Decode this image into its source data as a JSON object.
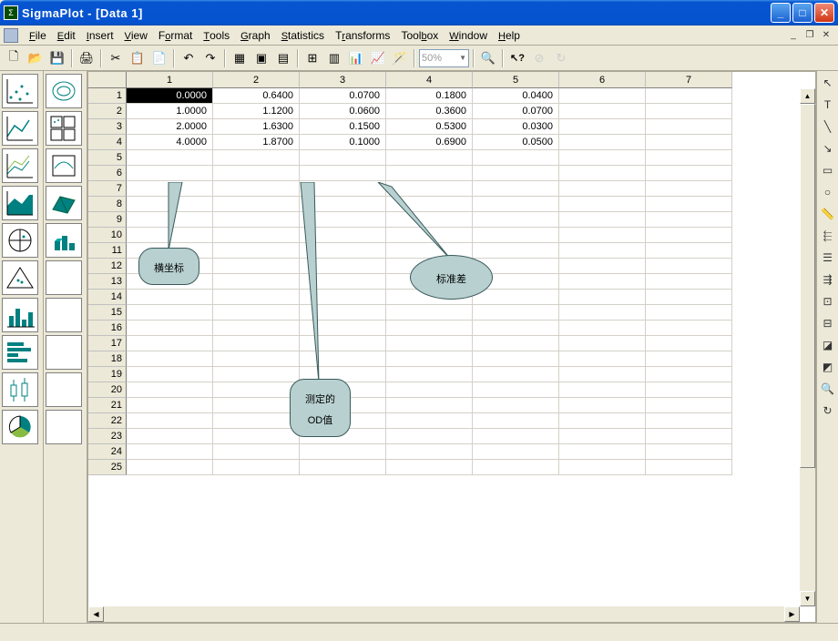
{
  "window": {
    "title": "SigmaPlot - [Data 1]"
  },
  "menu": {
    "items": [
      "File",
      "Edit",
      "Insert",
      "View",
      "Format",
      "Tools",
      "Graph",
      "Statistics",
      "Transforms",
      "Toolbox",
      "Window",
      "Help"
    ]
  },
  "toolbar": {
    "zoom": "50%"
  },
  "sheet": {
    "col_headers": [
      "1",
      "2",
      "3",
      "4",
      "5",
      "6",
      "7"
    ],
    "row_count": 25,
    "data": [
      [
        "0.0000",
        "0.6400",
        "0.0700",
        "0.1800",
        "0.0400",
        "",
        ""
      ],
      [
        "1.0000",
        "1.1200",
        "0.0600",
        "0.3600",
        "0.0700",
        "",
        ""
      ],
      [
        "2.0000",
        "1.6300",
        "0.1500",
        "0.5300",
        "0.0300",
        "",
        ""
      ],
      [
        "4.0000",
        "1.8700",
        "0.1000",
        "0.6900",
        "0.0500",
        "",
        ""
      ]
    ],
    "selected": {
      "row": 0,
      "col": 0
    }
  },
  "callouts": {
    "c1": "横坐标",
    "c2_line1": "测定的",
    "c2_line2": "OD值",
    "c3": "标准差"
  },
  "palette_names": [
    [
      "scatter-plot-icon",
      "contour-plot-icon"
    ],
    [
      "line-plot-icon",
      "scatter-matrix-icon"
    ],
    [
      "multi-line-icon",
      "polar-line-icon"
    ],
    [
      "area-plot-icon",
      "3d-surface-icon"
    ],
    [
      "polar-plot-icon",
      "3d-bar-icon"
    ],
    [
      "ternary-icon",
      "blank-icon"
    ],
    [
      "bar-chart-icon",
      "blank-icon"
    ],
    [
      "horizontal-bar-icon",
      "blank-icon"
    ],
    [
      "box-plot-icon",
      "blank-icon"
    ],
    [
      "pie-chart-icon",
      "blank-icon"
    ]
  ],
  "right_tools": [
    "pointer-icon",
    "text-tool-icon",
    "line-tool-icon",
    "arrow-tool-icon",
    "rect-tool-icon",
    "ellipse-tool-icon",
    "measure-icon",
    "align-left-icon",
    "align-center-icon",
    "align-right-icon",
    "group-icon",
    "ungroup-icon",
    "front-icon",
    "back-icon",
    "zoom-in-icon",
    "rotate-icon"
  ]
}
